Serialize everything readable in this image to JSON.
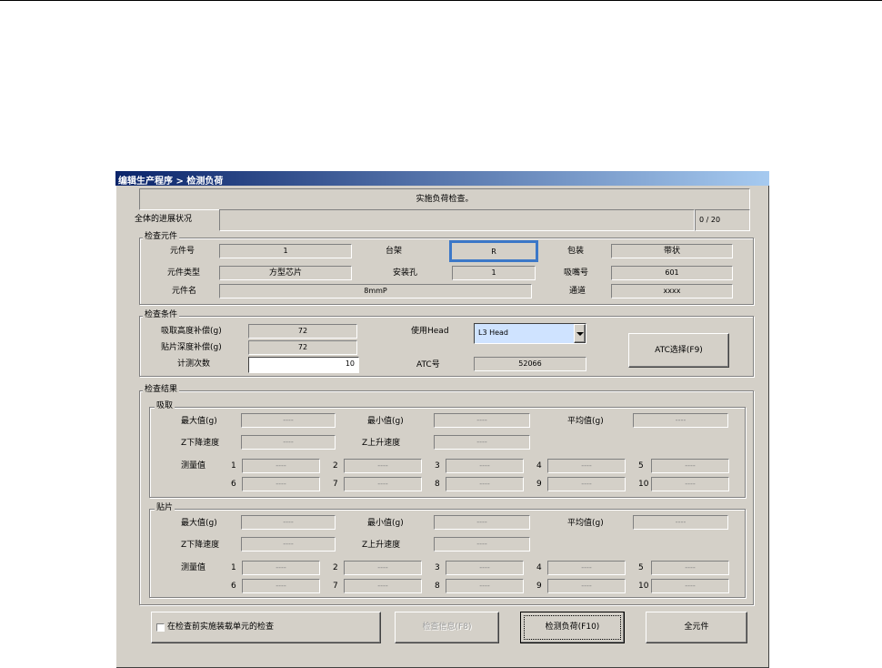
{
  "window_title": "编辑生产程序 > 检测负荷",
  "message": "实施负荷检查。",
  "progress": {
    "label": "全体的进展状况",
    "value": "0 / 20",
    "fraction": 0
  },
  "check_component": {
    "title": "检查元件",
    "part_no_label": "元件号",
    "part_no": "1",
    "rack_label": "台架",
    "rack": "R",
    "packaging_label": "包装",
    "packaging": "带状",
    "part_type_label": "元件类型",
    "part_type": "方型芯片",
    "hole_label": "安装孔",
    "hole": "1",
    "nozzle_label": "吸嘴号",
    "nozzle": "601",
    "part_name_label": "元件名",
    "part_name": "8mmP",
    "channel_label": "通道",
    "channel": "xxxx"
  },
  "conditions": {
    "title": "检查条件",
    "pick_height_label": "吸取高度补偿(g)",
    "pick_height": "72",
    "place_depth_label": "贴片深度补偿(g)",
    "place_depth": "72",
    "measure_count_label": "计测次数",
    "measure_count": "10",
    "use_head_label": "使用Head",
    "use_head": "L3 Head",
    "atc_label": "ATC号",
    "atc": "52066",
    "atc_button": "ATC选择(F9)"
  },
  "results": {
    "title": "检查结果",
    "pick": {
      "title": "吸取",
      "max_label": "最大值(g)",
      "max": "----",
      "min_label": "最小值(g)",
      "min": "----",
      "avg_label": "平均值(g)",
      "avg": "----",
      "z_down_label": "Z下降速度",
      "z_down": "----",
      "z_up_label": "Z上升速度",
      "z_up": "----",
      "measured_label": "测量值",
      "measured": [
        {
          "n": "1",
          "v": "----"
        },
        {
          "n": "2",
          "v": "----"
        },
        {
          "n": "3",
          "v": "----"
        },
        {
          "n": "4",
          "v": "----"
        },
        {
          "n": "5",
          "v": "----"
        },
        {
          "n": "6",
          "v": "----"
        },
        {
          "n": "7",
          "v": "----"
        },
        {
          "n": "8",
          "v": "----"
        },
        {
          "n": "9",
          "v": "----"
        },
        {
          "n": "10",
          "v": "----"
        }
      ]
    },
    "place": {
      "title": "贴片",
      "max_label": "最大值(g)",
      "max": "----",
      "min_label": "最小值(g)",
      "min": "----",
      "avg_label": "平均值(g)",
      "avg": "----",
      "z_down_label": "Z下降速度",
      "z_down": "----",
      "z_up_label": "Z上升速度",
      "z_up": "----",
      "measured_label": "测量值",
      "measured": [
        {
          "n": "1",
          "v": "----"
        },
        {
          "n": "2",
          "v": "----"
        },
        {
          "n": "3",
          "v": "----"
        },
        {
          "n": "4",
          "v": "----"
        },
        {
          "n": "5",
          "v": "----"
        },
        {
          "n": "6",
          "v": "----"
        },
        {
          "n": "7",
          "v": "----"
        },
        {
          "n": "8",
          "v": "----"
        },
        {
          "n": "9",
          "v": "----"
        },
        {
          "n": "10",
          "v": "----"
        }
      ]
    }
  },
  "footer": {
    "checkbox_label": "在检查前实施装载单元的检查",
    "checkbox_checked": false,
    "info_button": "检查信息(F8)",
    "check_load_button": "检测负荷(F10)",
    "all_parts_button": "全元件"
  },
  "colors": {
    "title_start": "#0a246a",
    "title_end": "#a6caf0",
    "face": "#d4d0c8",
    "highlight": "#3c78c8",
    "select_bg": "#cfe3ff"
  }
}
